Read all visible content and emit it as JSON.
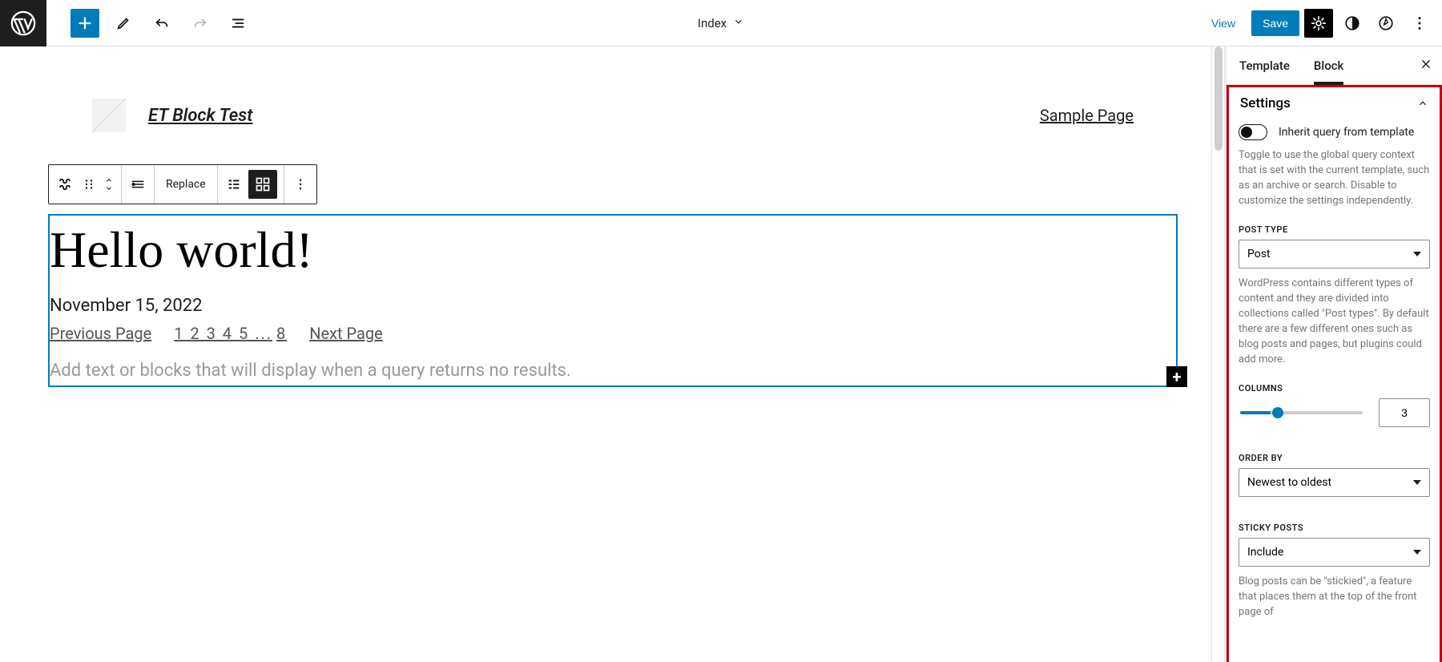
{
  "topbar": {
    "view_label": "View",
    "save_label": "Save",
    "doc_label": "Index"
  },
  "site": {
    "title": "ET Block Test",
    "nav_link": "Sample Page"
  },
  "toolbar": {
    "replace_label": "Replace"
  },
  "post": {
    "title": "Hello world!",
    "date": "November 15, 2022",
    "prev": "Previous Page",
    "next": "Next Page",
    "pages_before": "1 2 3 4 5 ...",
    "pages_last": "8",
    "no_results": "Add text or blocks that will display when a query returns no results."
  },
  "sidebar": {
    "tab_template": "Template",
    "tab_block": "Block",
    "panel_title": "Settings",
    "inherit_label": "Inherit query from template",
    "inherit_help": "Toggle to use the global query context that is set with the current template, such as an archive or search. Disable to customize the settings independently.",
    "post_type_label": "POST TYPE",
    "post_type_value": "Post",
    "post_type_help": "WordPress contains different types of content and they are divided into collections called \"Post types\". By default there are a few different ones such as blog posts and pages, but plugins could add more.",
    "columns_label": "COLUMNS",
    "columns_value": "3",
    "order_label": "ORDER BY",
    "order_value": "Newest to oldest",
    "sticky_label": "STICKY POSTS",
    "sticky_value": "Include",
    "sticky_help": "Blog posts can be \"stickied\", a feature that places them at the top of the front page of"
  }
}
